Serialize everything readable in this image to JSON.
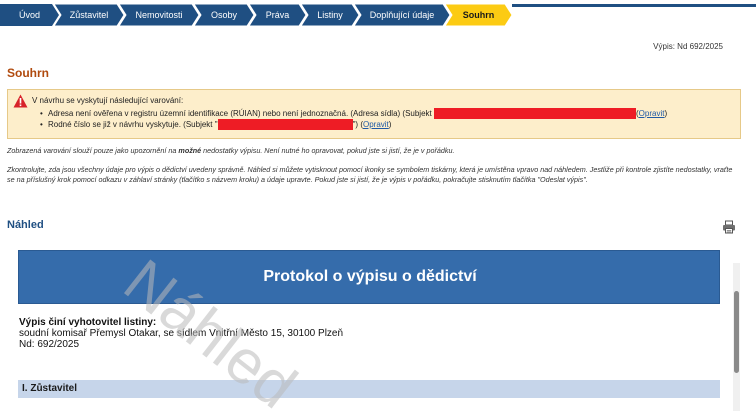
{
  "steps": [
    {
      "label": "Úvod",
      "active": false
    },
    {
      "label": "Zůstavitel",
      "active": false
    },
    {
      "label": "Nemovitosti",
      "active": false
    },
    {
      "label": "Osoby",
      "active": false
    },
    {
      "label": "Práva",
      "active": false
    },
    {
      "label": "Listiny",
      "active": false
    },
    {
      "label": "Doplňující údaje",
      "active": false
    },
    {
      "label": "Souhrn",
      "active": true
    }
  ],
  "colors": {
    "step_bg": "#1f4f82",
    "step_active": "#fccb13",
    "warning_bg": "#fdeecb",
    "accent_orange": "#b04a0e",
    "doc_header": "#356cab",
    "redaction": "#ee1c25"
  },
  "reference": "Výpis: Nd 692/2025",
  "summary": {
    "title": "Souhrn",
    "warning": {
      "icon": "warning-triangle-icon",
      "heading": "V návrhu se vyskytují následující varování:",
      "items": [
        {
          "text": "Adresa není ověřena v registru územní identifikace (RÚIAN) nebo není jednoznačná. (Adresa sídla) (Subjekt ",
          "link": "Opravit"
        },
        {
          "text": "Rodné číslo se již v návrhu vyskytuje. (Subjekt \"",
          "suffix": "\") ",
          "link": "Opravit"
        }
      ]
    },
    "note1_pre": "Zobrazená varování slouží pouze jako upozornění na ",
    "note1_bold": "možné",
    "note1_post": " nedostatky výpisu. Není nutné ho opravovat, pokud jste si jistí, že je v pořádku.",
    "note2": "Zkontrolujte, zda jsou všechny údaje pro výpis o dědictví uvedeny správně. Náhled si můžete vytisknout pomocí ikonky se symbolem tiskárny, která je umístěna vpravo nad náhledem. Jestliže při kontrole zjistíte nedostatky, vraťte se na příslušný krok pomocí odkazu v záhlaví stránky (tlačítko s názvem kroku) a údaje upravte. Pokud jste si jistí, že je výpis v pořádku, pokračujte stisknutím tlačítka \"Odeslat výpis\"."
  },
  "preview": {
    "title": "Náhled",
    "print_icon": "printer-icon",
    "doc_title": "Protokol o výpisu o dědictví",
    "issuer_label": "Výpis činí vyhotovitel listiny:",
    "issuer_line": "soudní komisař Přemysl Otakar, se sídlem Vnitřní Město 15, 30100 Plzeň",
    "issuer_ref": "Nd: 692/2025",
    "section1": "I. Zůstavitel",
    "watermark": "Náhled"
  }
}
